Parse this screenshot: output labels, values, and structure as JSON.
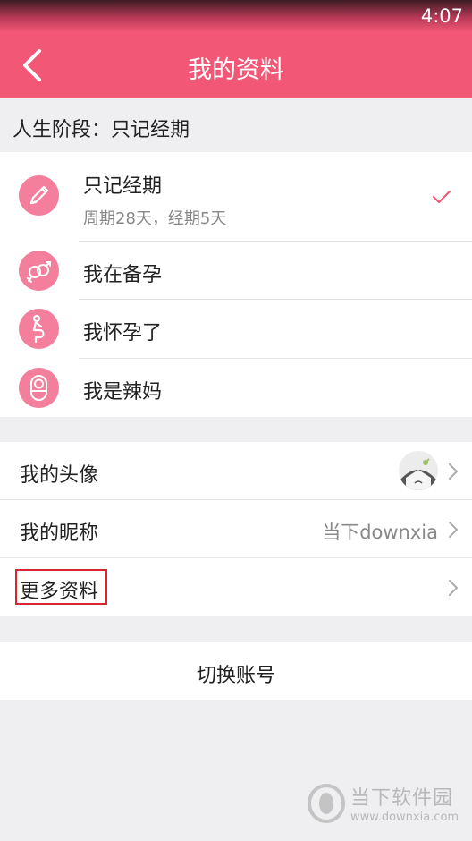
{
  "status_bar": {
    "time": "4:07"
  },
  "header": {
    "title": "我的资料",
    "back_icon": "chevron-left-icon"
  },
  "life_stage": {
    "label": "人生阶段：只记经期",
    "options": [
      {
        "name": "只记经期",
        "detail": "周期28天，经期5天",
        "selected": true,
        "icon": "pencil-icon"
      },
      {
        "name": "我在备孕",
        "icon": "gender-rings-icon"
      },
      {
        "name": "我怀孕了",
        "icon": "pregnant-icon"
      },
      {
        "name": "我是辣妈",
        "icon": "baby-icon"
      }
    ]
  },
  "profile": {
    "avatar_label": "我的头像",
    "nickname_label": "我的昵称",
    "nickname_value": "当下downxia",
    "more_label": "更多资料"
  },
  "switch_account_label": "切换账号",
  "watermark": {
    "name": "当下软件园",
    "url": "www.downxia.com"
  },
  "colors": {
    "brand": "#f25876",
    "icon_bg": "#f47f9c",
    "background": "#efeff1"
  }
}
